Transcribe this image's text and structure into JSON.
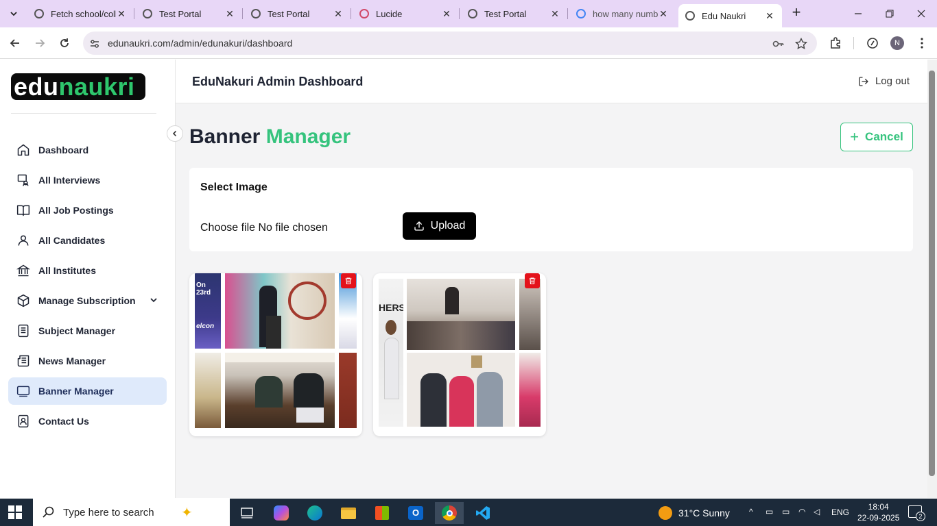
{
  "browser": {
    "tabs": [
      {
        "title": "Fetch school/colle",
        "active": false
      },
      {
        "title": "Test Portal",
        "active": false
      },
      {
        "title": "Test Portal",
        "active": false
      },
      {
        "title": "Lucide",
        "active": false
      },
      {
        "title": "Test Portal",
        "active": false
      },
      {
        "title": "how many numb",
        "active": false
      },
      {
        "title": "Edu Naukri",
        "active": true
      }
    ],
    "url": "edunaukri.com/admin/edunakuri/dashboard",
    "profile_initial": "N"
  },
  "logo": {
    "part1": "edu",
    "part2": "naukri"
  },
  "sidebar": {
    "items": [
      {
        "label": "Dashboard",
        "icon": "home-icon",
        "active": false
      },
      {
        "label": "All Interviews",
        "icon": "interviews-icon",
        "active": false
      },
      {
        "label": "All Job Postings",
        "icon": "book-open-icon",
        "active": false
      },
      {
        "label": "All Candidates",
        "icon": "user-icon",
        "active": false
      },
      {
        "label": "All Institutes",
        "icon": "landmark-icon",
        "active": false
      },
      {
        "label": "Manage Subscription",
        "icon": "package-icon",
        "active": false
      },
      {
        "label": "Subject Manager",
        "icon": "notebook-icon",
        "active": false
      },
      {
        "label": "News Manager",
        "icon": "newspaper-icon",
        "active": false
      },
      {
        "label": "Banner Manager",
        "icon": "monitor-icon",
        "active": true
      },
      {
        "label": "Contact Us",
        "icon": "contact-icon",
        "active": false
      }
    ]
  },
  "header": {
    "title": "EduNakuri Admin Dashboard",
    "logout_label": "Log out"
  },
  "page": {
    "title_part1": "Banner",
    "title_part2": "Manager",
    "cancel_label": "Cancel",
    "select_image_label": "Select Image",
    "file_input_text": "Choose file No file chosen",
    "upload_label": "Upload"
  },
  "banners": [
    {
      "name": "banner-1",
      "captions": [
        "On 23rd",
        "elcon"
      ]
    },
    {
      "name": "banner-2",
      "captions": [
        "HERS"
      ]
    }
  ],
  "colors": {
    "accent_green": "#35c37d",
    "active_nav_bg": "#dfeafb",
    "delete_red": "#e4121b"
  },
  "taskbar": {
    "search_placeholder": "Type here to search",
    "weather": "31°C  Sunny",
    "language": "ENG",
    "time": "18:04",
    "date": "22-09-2025",
    "notifications": "2"
  }
}
